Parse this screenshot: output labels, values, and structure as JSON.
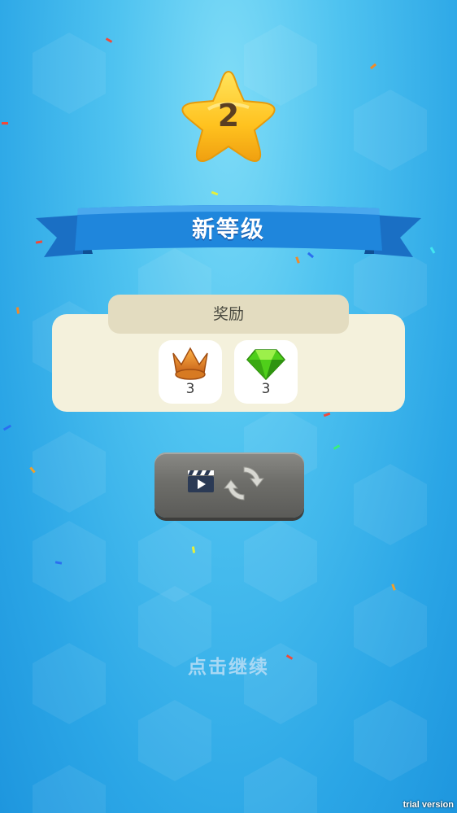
{
  "level": {
    "number": "2"
  },
  "banner": {
    "title": "新等级"
  },
  "rewards": {
    "header": "奖励",
    "items": [
      {
        "icon": "crown-icon",
        "count": "3"
      },
      {
        "icon": "gem-icon",
        "count": "3"
      }
    ]
  },
  "actions": {
    "video_button_icons": [
      "clapperboard-icon",
      "refresh-icon"
    ],
    "continue_label": "点击继续"
  },
  "watermark": "trial version",
  "colors": {
    "background": "#2ba6e6",
    "ribbon": "#1f7fd6",
    "star": "#ffc21f",
    "panel": "#f4f1dc",
    "button": "#6e6e6a"
  }
}
